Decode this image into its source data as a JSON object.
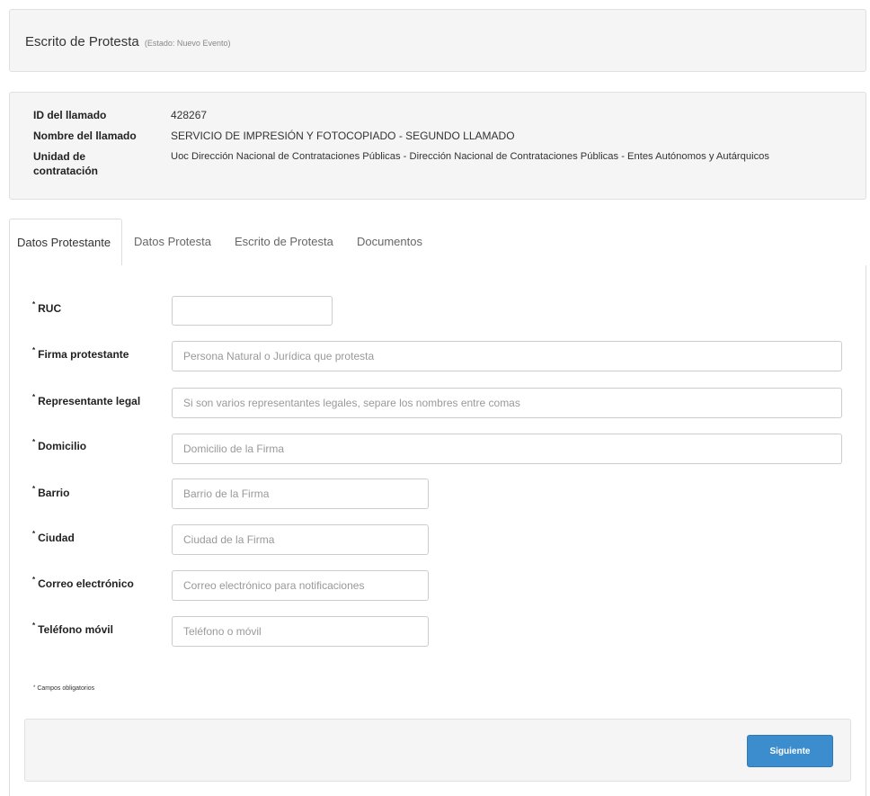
{
  "header": {
    "title": "Escrito de Protesta",
    "state": "(Estado: Nuevo Evento)"
  },
  "info": {
    "id_label": "ID del llamado",
    "id_value": "428267",
    "name_label": "Nombre del llamado",
    "name_value": "SERVICIO DE IMPRESIÓN Y FOTOCOPIADO - SEGUNDO LLAMADO",
    "unit_label": "Unidad de contratación",
    "unit_value": "Uoc Dirección Nacional de Contrataciones Públicas - Dirección Nacional de Contrataciones Públicas - Entes Autónomos y Autárquicos"
  },
  "tabs": [
    {
      "label": "Datos Protestante",
      "active": true
    },
    {
      "label": "Datos Protesta",
      "active": false
    },
    {
      "label": "Escrito de Protesta",
      "active": false
    },
    {
      "label": "Documentos",
      "active": false
    }
  ],
  "form": {
    "required_mark": "*",
    "fields": {
      "ruc": {
        "label": "RUC",
        "value": "",
        "placeholder": ""
      },
      "firma": {
        "label": "Firma protestante",
        "value": "",
        "placeholder": "Persona Natural o Jurídica que protesta"
      },
      "representante": {
        "label": "Representante legal",
        "value": "",
        "placeholder": "Si son varios representantes legales, separe los nombres entre comas"
      },
      "domicilio": {
        "label": "Domicilio",
        "value": "",
        "placeholder": "Domicilio de la Firma"
      },
      "barrio": {
        "label": "Barrio",
        "value": "",
        "placeholder": "Barrio de la Firma"
      },
      "ciudad": {
        "label": "Ciudad",
        "value": "",
        "placeholder": "Ciudad de la Firma"
      },
      "correo": {
        "label": "Correo electrónico",
        "value": "",
        "placeholder": "Correo electrónico para notificaciones"
      },
      "telefono": {
        "label": "Teléfono móvil",
        "value": "",
        "placeholder": "Teléfono o móvil"
      }
    },
    "required_note": "Campos obligatorios"
  },
  "footer": {
    "next_label": "Siguiente"
  },
  "colors": {
    "primary_button": "#3c8dce",
    "panel_bg": "#f5f5f5",
    "border": "#dddddd"
  }
}
